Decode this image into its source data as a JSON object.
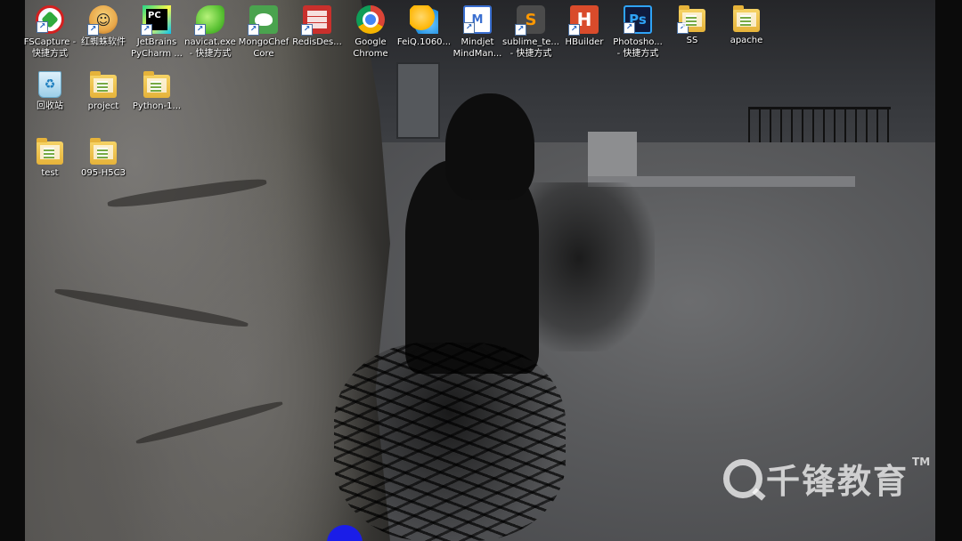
{
  "desktop": {
    "icons": [
      {
        "name": "fscapture-shortcut",
        "glyph": "fscapture",
        "line1": "FSCapture -",
        "line2": "快捷方式",
        "shortcut": true
      },
      {
        "name": "hongzhizhu-software",
        "glyph": "spider",
        "line1": "红蜘蛛软件",
        "line2": "",
        "shortcut": true
      },
      {
        "name": "pycharm-shortcut",
        "glyph": "pycharm",
        "line1": "JetBrains",
        "line2": "PyCharm ...",
        "shortcut": true
      },
      {
        "name": "navicat-shortcut",
        "glyph": "navicat",
        "line1": "navicat.exe",
        "line2": "- 快捷方式",
        "shortcut": true
      },
      {
        "name": "mongochef-shortcut",
        "glyph": "mongo",
        "line1": "MongoChef",
        "line2": "Core",
        "shortcut": true
      },
      {
        "name": "redis-desktop-shortcut",
        "glyph": "redis",
        "line1": "RedisDes...",
        "line2": "",
        "shortcut": true
      },
      {
        "name": "google-chrome-shortcut",
        "glyph": "chrome",
        "line1": "Google",
        "line2": "Chrome",
        "shortcut": false
      },
      {
        "name": "feiq-shortcut",
        "glyph": "feiq",
        "line1": "FeiQ.1060...",
        "line2": "",
        "shortcut": false
      },
      {
        "name": "mindjet-shortcut",
        "glyph": "mindjet",
        "line1": "Mindjet",
        "line2": "MindMan...",
        "shortcut": true
      },
      {
        "name": "sublime-shortcut",
        "glyph": "sublime",
        "line1": "sublime_te...",
        "line2": "- 快捷方式",
        "shortcut": true
      },
      {
        "name": "hbuilder-shortcut",
        "glyph": "hbuilder",
        "line1": "HBuilder",
        "line2": "",
        "shortcut": true
      },
      {
        "name": "photoshop-shortcut",
        "glyph": "ps",
        "line1": "Photosho...",
        "line2": "- 快捷方式",
        "shortcut": true
      },
      {
        "name": "ss-shortcut",
        "glyph": "folder",
        "line1": "SS",
        "line2": "",
        "shortcut": true
      },
      {
        "name": "apache-folder",
        "glyph": "folder",
        "line1": "apache",
        "line2": "",
        "shortcut": false
      },
      {
        "name": "recycle-bin",
        "glyph": "recycle",
        "line1": "回收站",
        "line2": "",
        "shortcut": false
      },
      {
        "name": "project-folder",
        "glyph": "folder",
        "line1": "project",
        "line2": "",
        "shortcut": false
      },
      {
        "name": "python-folder",
        "glyph": "folder",
        "line1": "Python-1...",
        "line2": "",
        "shortcut": false
      },
      {
        "name": "test-folder",
        "glyph": "folder",
        "line1": "test",
        "line2": "",
        "shortcut": false
      },
      {
        "name": "095-h5c3-folder",
        "glyph": "folder",
        "line1": "095-H5C3",
        "line2": "",
        "shortcut": false
      }
    ]
  },
  "watermark": {
    "text": "千锋教育",
    "tm": "TM"
  },
  "glyph_text": {
    "spider": "☺",
    "pycharm": "PC",
    "mindjet": "M",
    "sublime": "S",
    "hbuilder": "H",
    "ps": "Ps",
    "recycle": "♻",
    "shortcut_arrow": "↗"
  },
  "colors": {
    "accent_watermark": "#ffffff",
    "blue_cursor_dot": "#1a1de8"
  }
}
